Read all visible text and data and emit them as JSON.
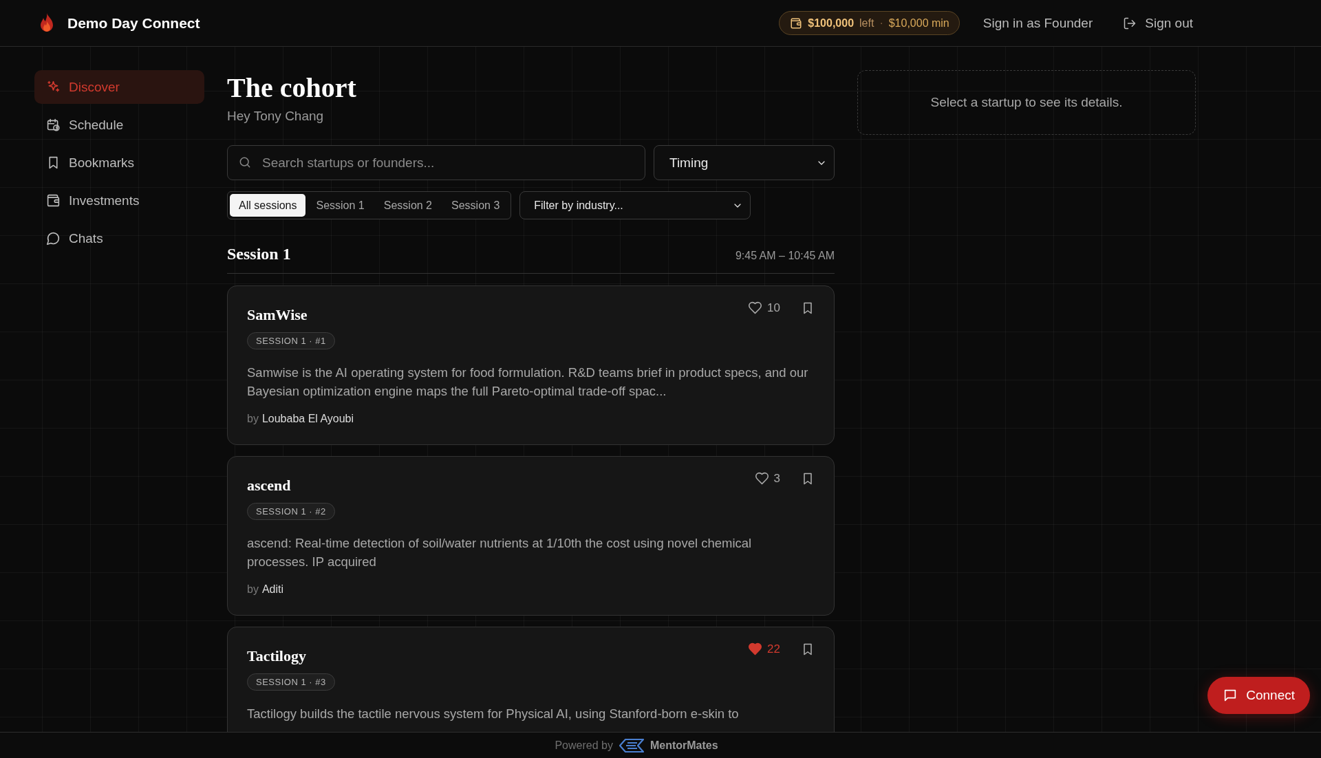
{
  "header": {
    "brand": "Demo Day Connect",
    "budget": {
      "amount": "$100,000",
      "left": "left",
      "separator": "·",
      "min": "$10,000 min"
    },
    "sign_in": "Sign in as Founder",
    "sign_out": "Sign out"
  },
  "sidebar": {
    "items": [
      {
        "label": "Discover",
        "selected": true
      },
      {
        "label": "Schedule",
        "selected": false
      },
      {
        "label": "Bookmarks",
        "selected": false
      },
      {
        "label": "Investments",
        "selected": false
      },
      {
        "label": "Chats",
        "selected": false
      }
    ]
  },
  "main": {
    "title": "The cohort",
    "greeting": "Hey Tony Chang",
    "search": {
      "placeholder": "Search startups or founders..."
    },
    "sort": {
      "value": "Timing"
    },
    "session_tabs": [
      {
        "label": "All sessions",
        "selected": true
      },
      {
        "label": "Session 1",
        "selected": false
      },
      {
        "label": "Session 2",
        "selected": false
      },
      {
        "label": "Session 3",
        "selected": false
      }
    ],
    "industry_filter": {
      "placeholder": "Filter by industry..."
    }
  },
  "sections": [
    {
      "title": "Session 1",
      "time": "9:45 AM – 10:45 AM",
      "startups": [
        {
          "name": "SamWise",
          "tag": "SESSION 1 · #1",
          "likes": "10",
          "liked": false,
          "description": "Samwise is the AI operating system for food formulation. R&D teams brief in product specs, and our Bayesian optimization engine maps the full Pareto-optimal trade-off spac...",
          "by": "by",
          "founder": "Loubaba El Ayoubi"
        },
        {
          "name": "ascend",
          "tag": "SESSION 1 · #2",
          "likes": "3",
          "liked": false,
          "description": "ascend: Real-time detection of soil/water nutrients at 1/10th the cost using novel chemical processes. IP acquired",
          "by": "by",
          "founder": "Aditi"
        },
        {
          "name": "Tactilogy",
          "tag": "SESSION 1 · #3",
          "likes": "22",
          "liked": true,
          "description": "Tactilogy builds the tactile nervous system for Physical AI, using Stanford-born e-skin to"
        }
      ]
    }
  ],
  "detail": {
    "placeholder": "Select a startup to see its details."
  },
  "connect_button": "Connect",
  "footer": {
    "powered_by": "Powered by",
    "brand": "MentorMates"
  }
}
